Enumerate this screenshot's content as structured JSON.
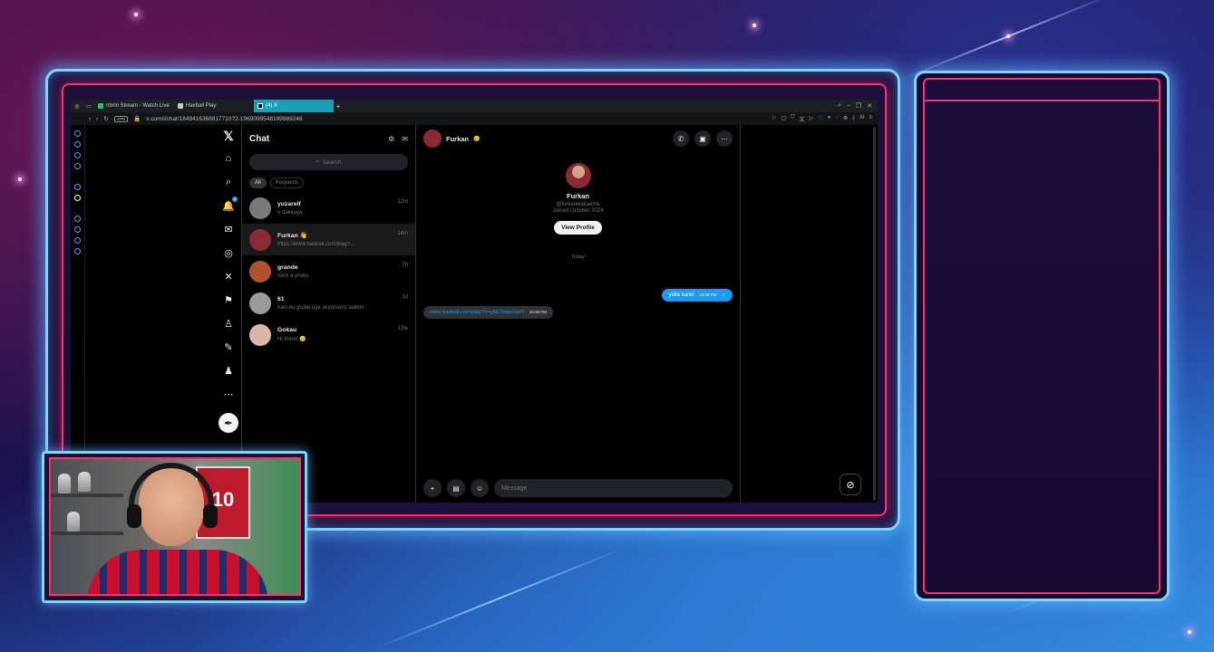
{
  "browser": {
    "tabs": [
      {
        "label": "rrbrin Stream - Watch Live",
        "color": "#22c55e"
      },
      {
        "label": "Haxball Play",
        "color": "#c9c9c9"
      },
      {
        "label": "(4) X",
        "color": "#000000"
      }
    ],
    "new_tab": "+",
    "url": "x.com/i/chat/1848416368817710?2-1969099548199989248",
    "vpn_label": "VPN",
    "ai_label": "AI"
  },
  "x_nav": {
    "items": [
      {
        "name": "x-logo-icon",
        "glyph": "𝕏"
      },
      {
        "name": "home-icon",
        "glyph": "⌂"
      },
      {
        "name": "search-icon",
        "glyph": "⌕"
      },
      {
        "name": "notifications-icon",
        "glyph": "🔔"
      },
      {
        "name": "messages-icon",
        "glyph": "✉"
      },
      {
        "name": "grok-icon",
        "glyph": "◎"
      },
      {
        "name": "x-premium-icon",
        "glyph": "✕"
      },
      {
        "name": "bookmarks-icon",
        "glyph": "⚑"
      },
      {
        "name": "communities-icon",
        "glyph": "♙"
      },
      {
        "name": "edit-icon",
        "glyph": "✎"
      },
      {
        "name": "profile-icon",
        "glyph": "♟"
      },
      {
        "name": "more-icon",
        "glyph": "⋯"
      }
    ],
    "notification_badge": "4",
    "compose_glyph": "✒"
  },
  "chat_list": {
    "title": "Chat",
    "search_placeholder": "Search",
    "filters": [
      "All",
      "Requests"
    ],
    "conversations": [
      {
        "name": "yuzarelf",
        "preview": "5 dakkaya",
        "time": "12m",
        "avatar": "#7a7a7a"
      },
      {
        "name": "Furkan 👋",
        "preview": "https://www.haxball.com/play?...",
        "time": "14m",
        "avatar": "#8a2a33",
        "selected": true
      },
      {
        "name": "grande",
        "preview": "Sent a photo",
        "time": "7h",
        "avatar": "#b1522c"
      },
      {
        "name": "61",
        "preview": "haci bu grube üye alıyorsanz talibim",
        "time": "1d",
        "avatar": "#9a9a9a"
      },
      {
        "name": "Gokau",
        "preview": "Hi there! 😊",
        "time": "19w",
        "avatar": "#d8b9a8"
      }
    ]
  },
  "chat_pane": {
    "header_name": "Furkan",
    "profile": {
      "name": "Furkan",
      "handle": "@furkanwakaeme",
      "joined": "Joined October 2024",
      "button": "View Profile"
    },
    "day_separator": "Today",
    "messages": [
      {
        "dir": "out",
        "text": "yolla kanki",
        "time": "10:36 PM"
      },
      {
        "dir": "in",
        "text": "www.haxball.com/play?c=g6E7kweXsdY",
        "time": "10:36 PM"
      }
    ],
    "composer_placeholder": "Message"
  },
  "webcam": {
    "jersey_number": "10"
  },
  "colors": {
    "x_blue": "#1d9bf0",
    "frame_neon_blue": "#7fd3ff",
    "frame_neon_pink": "#ff2f6e",
    "active_tab": "#1a9fb6"
  }
}
